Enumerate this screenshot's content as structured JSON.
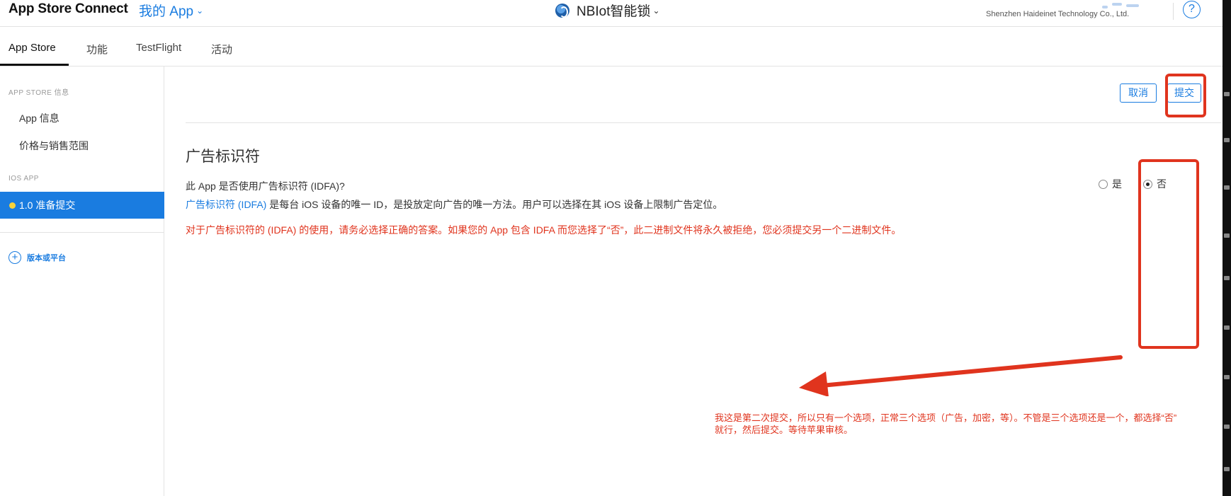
{
  "header": {
    "brand": "App Store Connect",
    "my_apps": "我的 App",
    "app_name": "NBIot智能锁",
    "company": "Shenzhen Haideinet Technology Co., Ltd.",
    "help": "?",
    "chevron": "⌄"
  },
  "tabs": [
    {
      "label": "App Store"
    },
    {
      "label": "功能"
    },
    {
      "label": "TestFlight"
    },
    {
      "label": "活动"
    }
  ],
  "sidebar": {
    "section_app_store": "APP STORE 信息",
    "app_info": "App 信息",
    "pricing": "价格与销售范围",
    "section_ios": "IOS APP",
    "version": "1.0 准备提交",
    "add_version": "版本或平台"
  },
  "actions": {
    "cancel": "取消",
    "submit": "提交"
  },
  "idfa": {
    "title": "广告标识符",
    "question": "此 App 是否使用广告标识符 (IDFA)?",
    "link": "广告标识符 (IDFA)",
    "description": " 是每台 iOS 设备的唯一 ID，是投放定向广告的唯一方法。用户可以选择在其 iOS 设备上限制广告定位。",
    "warning": "对于广告标识符的 (IDFA) 的使用，请务必选择正确的答案。如果您的 App 包含 IDFA 而您选择了“否”，此二进制文件将永久被拒绝，您必须提交另一个二进制文件。",
    "option_yes": "是",
    "option_no": "否",
    "selected": "否"
  },
  "annotation": {
    "note_line1": "我这是第二次提交，所以只有一个选项，正常三个选项（广告，加密，等）。不管是三个选项还是一个，都选择“否”",
    "note_line2": "就行，然后提交。等待苹果审核。",
    "color": "#e0341e"
  },
  "colors": {
    "accent": "#1a7ce0",
    "warning": "#e0341e",
    "selected_dot": "#f7d23a"
  }
}
